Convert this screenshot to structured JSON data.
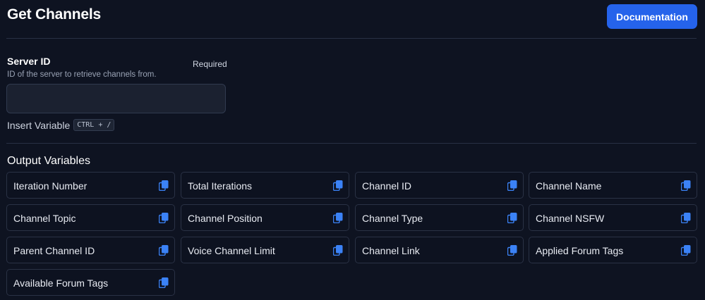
{
  "header": {
    "title": "Get Channels",
    "documentation_label": "Documentation"
  },
  "server_field": {
    "label": "Server ID",
    "required_text": "Required",
    "description": "ID of the server to retrieve channels from.",
    "value": "",
    "insert_variable_label": "Insert Variable",
    "shortcut": "CTRL + /"
  },
  "output": {
    "title": "Output Variables",
    "variables": [
      "Iteration Number",
      "Total Iterations",
      "Channel ID",
      "Channel Name",
      "Channel Topic",
      "Channel Position",
      "Channel Type",
      "Channel NSFW",
      "Parent Channel ID",
      "Voice Channel Limit",
      "Channel Link",
      "Applied Forum Tags",
      "Available Forum Tags"
    ]
  },
  "colors": {
    "background": "#0e1321",
    "accent": "#2563eb",
    "copy_icon": "#3b82f6",
    "border": "#2a3245"
  },
  "icons": {
    "copy": "copy-icon"
  }
}
